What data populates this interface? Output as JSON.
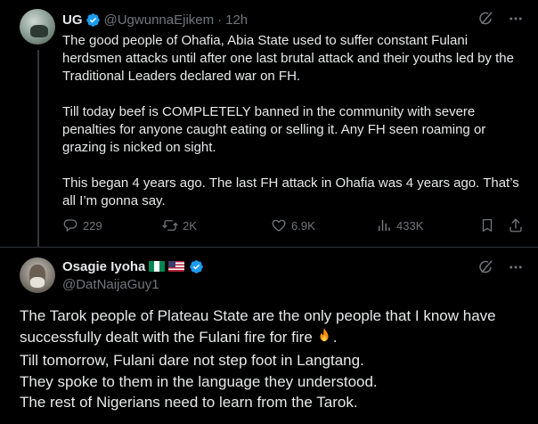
{
  "tweet1": {
    "name": "UG",
    "handle": "@UgwunnaEjikem",
    "separator": "·",
    "time": "12h",
    "paragraphs": [
      "The good people of Ohafia, Abia State used to suffer constant Fulani herdsmen attacks until after one last brutal attack and their youths led by the Traditional Leaders declared war on FH.",
      "Till today beef is COMPLETELY banned in the community with severe penalties for anyone caught eating or selling it. Any FH seen roaming or grazing is nicked on sight.",
      "This began 4 years ago. The last FH attack in Ohafia was 4 years ago. That’s all I’m gonna say."
    ],
    "stats": {
      "replies": "229",
      "reposts": "2K",
      "likes": "6.9K",
      "views": "433K"
    }
  },
  "tweet2": {
    "name": "Osagie Iyoha",
    "handle": "@DatNaijaGuy1",
    "lines": [
      "The Tarok people of Plateau State are the only people that I know have",
      "successfully dealt with the Fulani fire for fire",
      "Till tomorrow, Fulani dare not step foot in Langtang.",
      "They spoke to them in the language they understood.",
      "The rest of Nigerians need to learn from the Tarok."
    ],
    "line2_suffix": "."
  },
  "colors": {
    "background": "#000000",
    "text": "#e7e9ea",
    "secondary": "#71767b",
    "verified": "#1d9bf0",
    "divider": "#2f3336"
  },
  "icons": [
    "verified-badge-icon",
    "grok-icon",
    "more-icon",
    "reply-icon",
    "repost-icon",
    "like-icon",
    "views-icon",
    "bookmark-icon",
    "share-icon",
    "fire-emoji",
    "nigeria-flag",
    "us-flag"
  ]
}
